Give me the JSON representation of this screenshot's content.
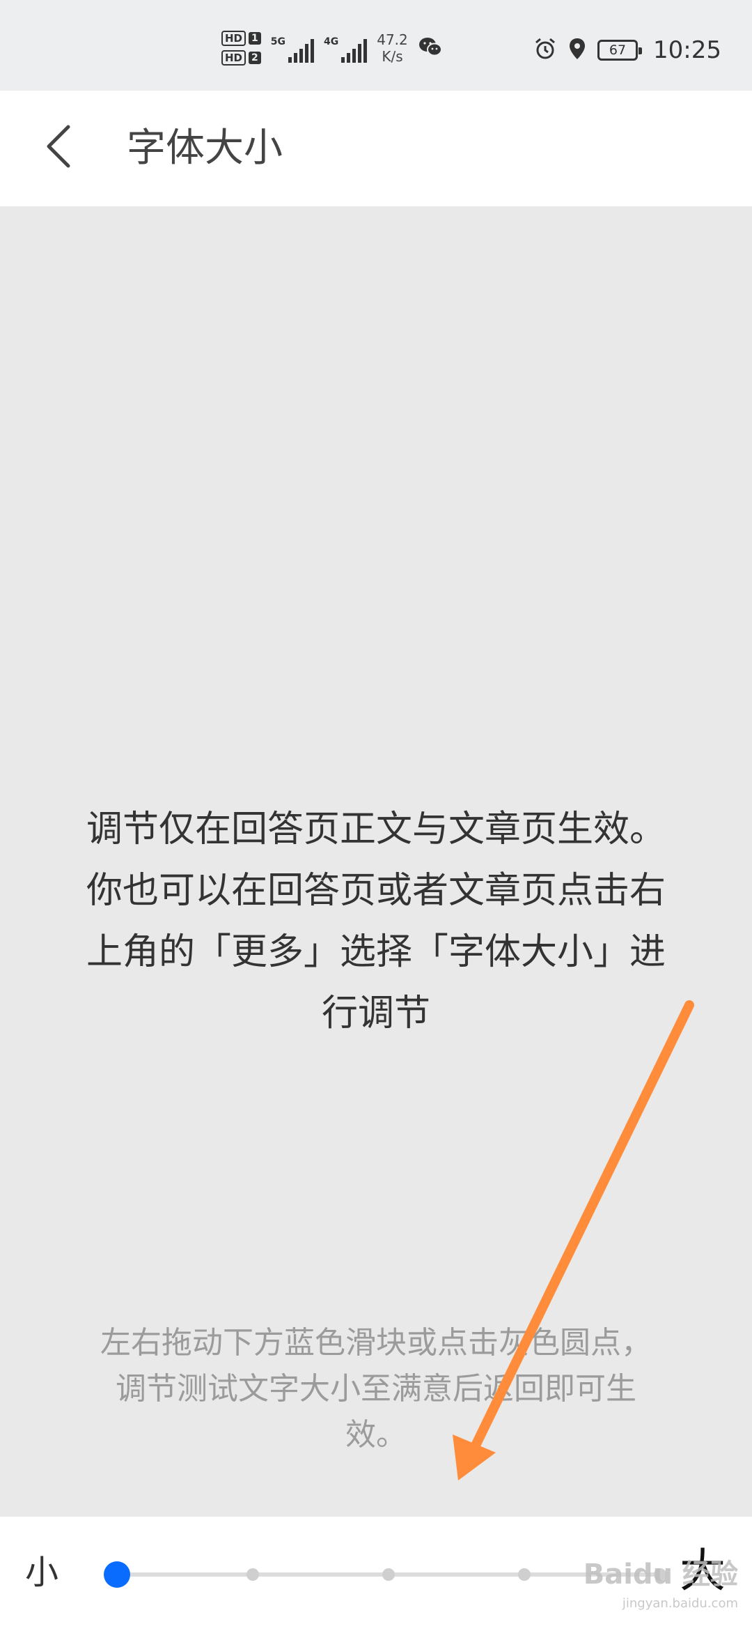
{
  "status_bar": {
    "sim1": {
      "label": "HD",
      "num": "1"
    },
    "sim2": {
      "label": "HD",
      "num": "2"
    },
    "net1": "5G",
    "net2": "4G",
    "speed_value": "47.2",
    "speed_unit": "K/s",
    "battery": "67",
    "time": "10:25",
    "icons": [
      "wechat-icon",
      "alarm-icon",
      "location-icon",
      "battery-icon"
    ]
  },
  "header": {
    "title": "字体大小",
    "back_icon": "chevron-left-icon"
  },
  "main": {
    "description_lines": [
      "调节仅在回答页正文与文章页生效。",
      "你也可以在回答页或者文章页点击右",
      "上角的「更多」选择「字体大小」进",
      "行调节"
    ],
    "hint_lines": [
      "左右拖动下方蓝色滑块或点击灰色圆点，",
      "调节测试文字大小至满意后返回即可生",
      "效。"
    ]
  },
  "slider": {
    "min_label": "小",
    "max_label": "大",
    "value_fraction": 0.0,
    "accent_color": "#0a6cff"
  },
  "annotation": {
    "arrow_color": "#ff8c3a"
  },
  "watermark": {
    "text": "Baidu 经验",
    "sub": "jingyan.baidu.com"
  }
}
